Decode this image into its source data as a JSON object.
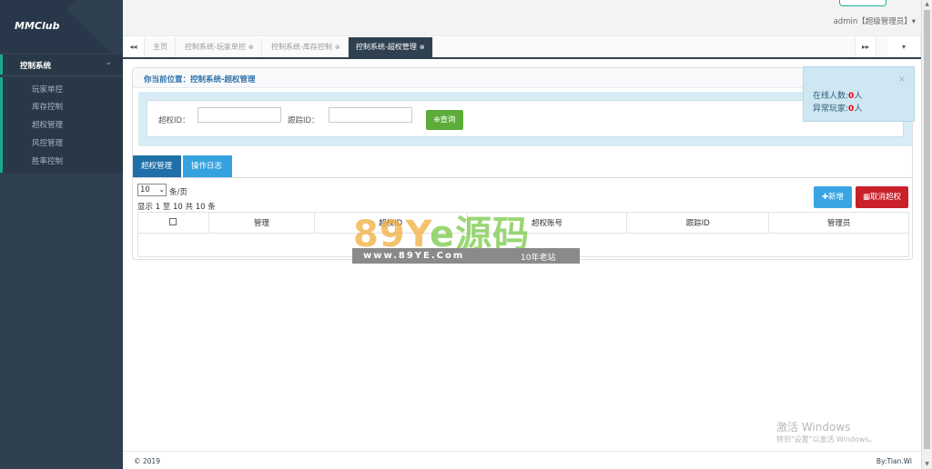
{
  "brand": {
    "name": "MMClub"
  },
  "sidebar": {
    "section_label": "控制系统",
    "section_arrow": "⌄",
    "items": [
      {
        "label": "玩家单控"
      },
      {
        "label": "库存控制"
      },
      {
        "label": "超权管理"
      },
      {
        "label": "风控管理"
      },
      {
        "label": "胜率控制"
      }
    ]
  },
  "header": {
    "user": "admin【超级管理员】▾"
  },
  "tabs": {
    "prev_icon": "◂◂",
    "next_icon": "▸▸",
    "menu_icon": "▾",
    "items": [
      {
        "label": "主页"
      },
      {
        "label": "控制系统-玩家单控"
      },
      {
        "label": "控制系统-库存控制"
      },
      {
        "label": "控制系统-超权管理"
      }
    ],
    "close_icon": "⊗"
  },
  "breadcrumb": "你当前位置：控制系统-超权管理",
  "search": {
    "superid_label": "超权ID：",
    "trackid_label": "跟踪ID：",
    "query_label": "查询",
    "query_icon": "⊕"
  },
  "panel_tabs": [
    {
      "label": "超权管理"
    },
    {
      "label": "操作日志"
    }
  ],
  "pagination": {
    "page_size": "10",
    "per_page_label": "条/页",
    "info": "显示 1 至 10 共 10 条"
  },
  "buttons": {
    "add": "✚新增",
    "cancel": "▦取消超权"
  },
  "table": {
    "columns": [
      "",
      "管理",
      "超权ID",
      "超权账号",
      "跟踪ID",
      "管理员"
    ]
  },
  "notice": {
    "close": "×",
    "online_label": "在线人数:",
    "online_value": "0",
    "online_unit": "人",
    "abnormal_label": "异常玩家:",
    "abnormal_value": "0",
    "abnormal_unit": "人"
  },
  "footer": {
    "copyright": "© 2019",
    "author": "By:Tian.Wi"
  },
  "watermark": {
    "big1": "89Y",
    "big2": "e源码",
    "url": "www.89YE.Com",
    "years": "10年老站"
  },
  "activation": {
    "title": "激活 Windows",
    "subtitle": "转到\"设置\"以激活 Windows。"
  },
  "colors": {
    "sidebar": "#2f4050",
    "accent": "#1ab394",
    "query": "#5cac39",
    "add": "#39a5e3",
    "cancel": "#c9202a"
  }
}
